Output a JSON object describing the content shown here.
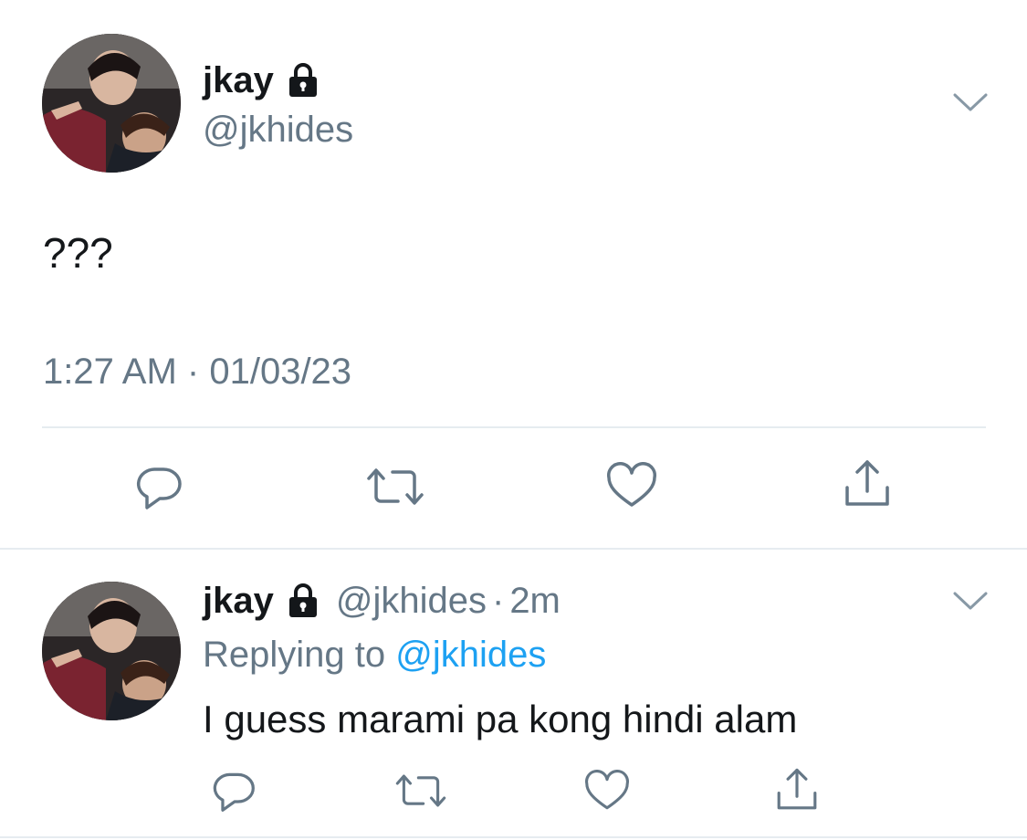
{
  "main_tweet": {
    "display_name": "jkay",
    "handle": "@jkhides",
    "text": "???",
    "time": "1:27 AM",
    "separator": "·",
    "date": "01/03/23",
    "protected_icon": "lock-icon",
    "menu_icon": "chevron-down-icon"
  },
  "reply_tweet": {
    "display_name": "jkay",
    "handle": "@jkhides",
    "separator": "·",
    "time_ago": "2m",
    "replying_prefix": "Replying to",
    "replying_handle": "@jkhides",
    "text": "I guess marami pa kong hindi alam",
    "protected_icon": "lock-icon",
    "menu_icon": "chevron-down-icon"
  },
  "actions": [
    "reply-icon",
    "retweet-icon",
    "like-icon",
    "share-icon"
  ],
  "colors": {
    "text_primary": "#14171a",
    "text_secondary": "#657786",
    "link": "#1da1f2",
    "divider": "#e6ecf0",
    "icon": "#657786"
  }
}
